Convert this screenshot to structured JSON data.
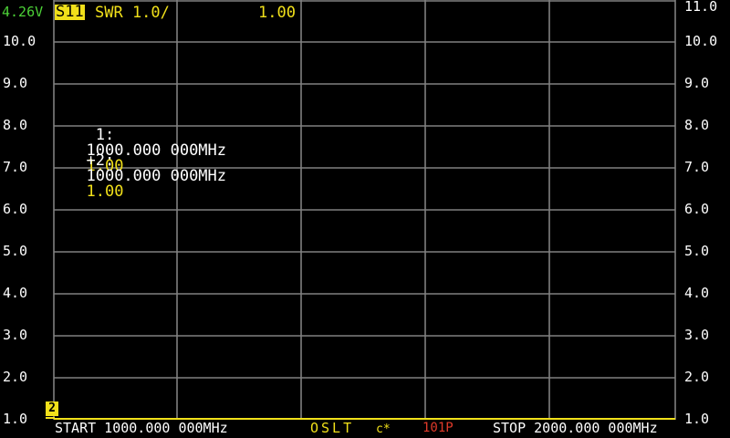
{
  "status": {
    "voltage": "4.26V",
    "voltage_color": "#4cd137"
  },
  "trace": {
    "channel": "S11",
    "format_scale": "SWR 1.0/",
    "value": "1.00",
    "color": "#f1e01a"
  },
  "y_axis_left": [
    "10.0",
    "9.0",
    "8.0",
    "7.0",
    "6.0",
    "5.0",
    "4.0",
    "3.0",
    "2.0",
    "1.0"
  ],
  "y_axis_right": [
    "11.0",
    "10.0",
    "9.0",
    "8.0",
    "7.0",
    "6.0",
    "5.0",
    "4.0",
    "3.0",
    "2.0",
    "1.0"
  ],
  "markers": [
    {
      "label": " 1:",
      "freq": "1000.000 000MHz",
      "value": "1.00"
    },
    {
      "label": "+2:",
      "freq": "1000.000 000MHz",
      "value": "1.00"
    }
  ],
  "reference_marker": {
    "label": "2",
    "icon": "marker-flag-icon"
  },
  "footer": {
    "start": "START 1000.000 000MHz",
    "calibration": "OSLT",
    "calibration_flag": "c*",
    "points": "101P",
    "stop": "STOP 2000.000 000MHz"
  },
  "colors": {
    "background": "#000000",
    "grid": "#808080",
    "trace": "#f1e01a",
    "points": "#e03a2a"
  }
}
